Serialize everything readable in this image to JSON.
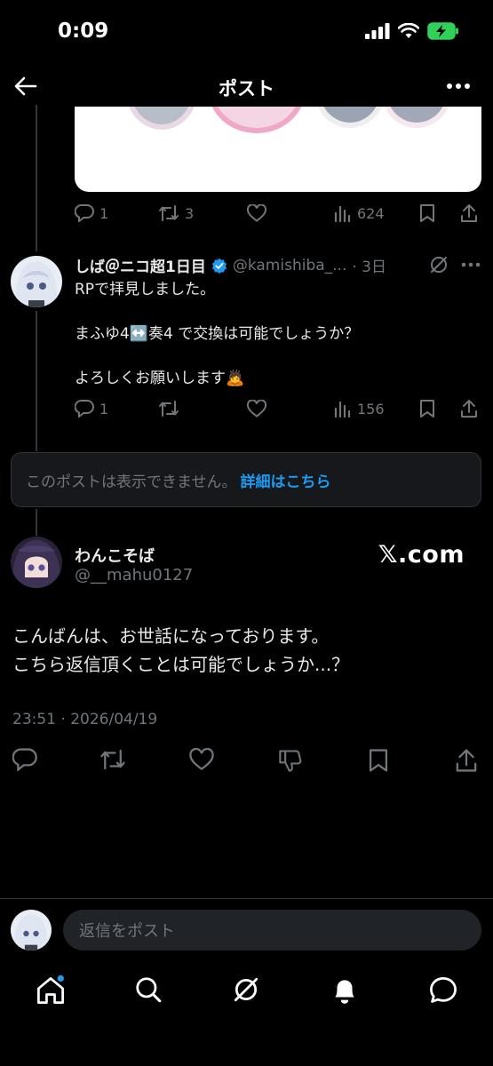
{
  "status_bar": {
    "time": "0:09"
  },
  "header": {
    "title": "ポスト"
  },
  "first_post": {
    "actions": {
      "replies": "1",
      "reposts": "3",
      "views": "624"
    }
  },
  "reply_post": {
    "name": "しば＠ニコ超1日目",
    "handle": "@kamishiba_...",
    "time": "· 3日",
    "lines": [
      "RPで拝見しました。",
      "まふゆ4↔️奏4 で交換は可能でしょうか？",
      "よろしくお願いします🙇"
    ],
    "actions": {
      "replies": "1",
      "views": "156"
    }
  },
  "unavailable": {
    "text": "このポストは表示できません。",
    "link": "詳細はこちら"
  },
  "main_post": {
    "name": "わんこそば",
    "handle": "@__mahu0127",
    "watermark": "𝕏.com",
    "lines": [
      "こんばんは、お世話になっております。",
      "こちら返信頂くことは可能でしょうか...？"
    ],
    "timestamp": "23:51 · 2026/04/19"
  },
  "reply_bar": {
    "placeholder": "返信をポスト"
  },
  "colors": {
    "accent": "#1d9bf0",
    "muted": "#71767b",
    "background": "#000000"
  }
}
